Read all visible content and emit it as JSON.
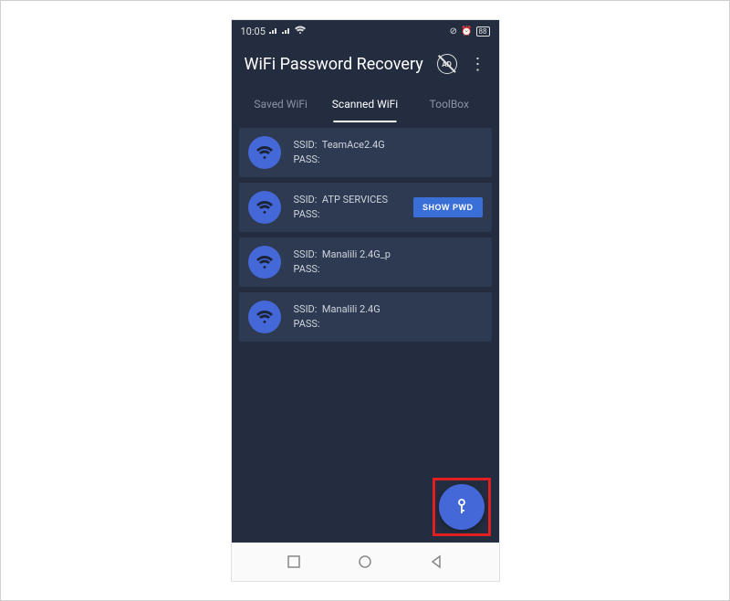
{
  "status": {
    "time": "10:05",
    "battery": "88"
  },
  "header": {
    "title": "WiFi Password Recovery"
  },
  "tabs": {
    "saved": "Saved WiFi",
    "scanned": "Scanned WiFi",
    "toolbox": "ToolBox"
  },
  "wifi_items": [
    {
      "ssid_label": "SSID:",
      "ssid": "TeamAce2.4G",
      "pass_label": "PASS:",
      "pass": ""
    },
    {
      "ssid_label": "SSID:",
      "ssid": "ATP SERVICES",
      "pass_label": "PASS:",
      "pass": ""
    },
    {
      "ssid_label": "SSID:",
      "ssid": "Manalili 2.4G_p",
      "pass_label": "PASS:",
      "pass": ""
    },
    {
      "ssid_label": "SSID:",
      "ssid": "Manalili 2.4G",
      "pass_label": "PASS:",
      "pass": ""
    }
  ],
  "buttons": {
    "show_pwd": "SHOW PWD"
  }
}
